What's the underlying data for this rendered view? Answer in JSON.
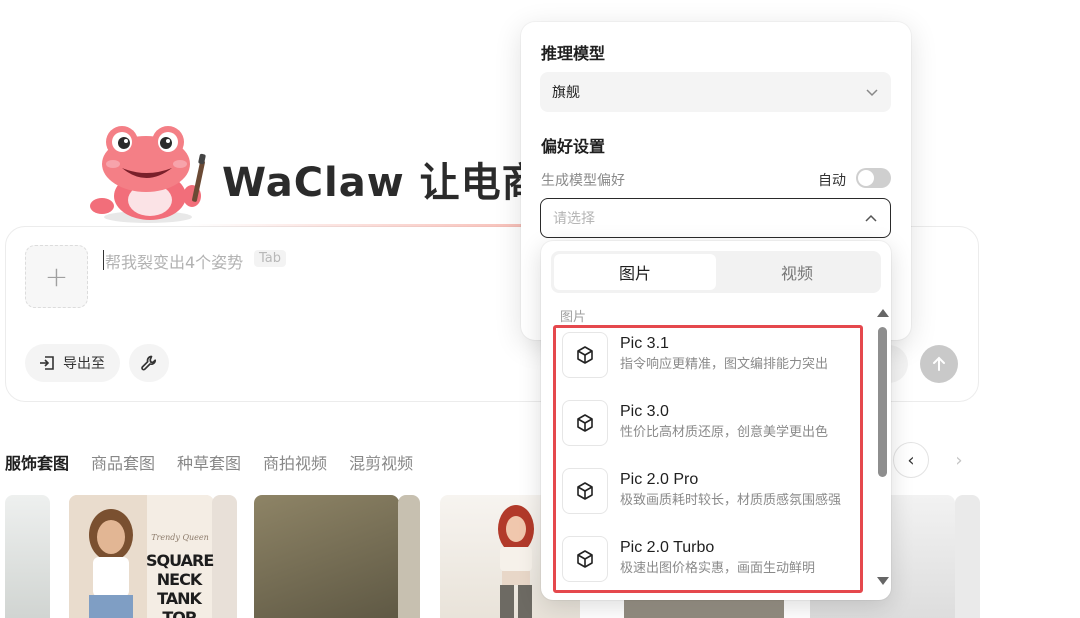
{
  "hero": {
    "title": "WaClaw 让电商"
  },
  "composer": {
    "placeholder": "帮我裂变出4个姿势",
    "tab_hint": "Tab",
    "upload_icon": "plus-icon",
    "export_label": "导出至",
    "export_icon": "export-icon",
    "tools_icon": "wrench-icon",
    "send_icon": "arrow-up-icon"
  },
  "categories": {
    "tabs": [
      "服饰套图",
      "商品套图",
      "种草套图",
      "商拍视频",
      "混剪视频"
    ],
    "active_index": 0,
    "prev_icon": "chevron-left-icon",
    "next_icon": "chevron-right-icon"
  },
  "gallery": {
    "poster_script": "Trendy Queen",
    "poster_title": "SQUARE NECK TANK TOP"
  },
  "settings_panel": {
    "reasoning_heading": "推理模型",
    "reasoning_value": "旗舰",
    "preferences_heading": "偏好设置",
    "gen_model_label": "生成模型偏好",
    "auto_label": "自动",
    "auto_enabled": false,
    "model_select_placeholder": "请选择"
  },
  "model_popover": {
    "tabs": [
      "图片",
      "视频"
    ],
    "active_tab": 0,
    "group_label": "图片",
    "models": [
      {
        "name": "Pic 3.1",
        "desc": "指令响应更精准，图文编排能力突出",
        "icon": "cube-icon"
      },
      {
        "name": "Pic 3.0",
        "desc": "性价比高材质还原，创意美学更出色",
        "icon": "cube-icon"
      },
      {
        "name": "Pic 2.0 Pro",
        "desc": "极致画质耗时较长，材质质感氛围感强",
        "icon": "cube-icon"
      },
      {
        "name": "Pic 2.0 Turbo",
        "desc": "极速出图价格实惠，画面生动鲜明",
        "icon": "cube-icon"
      }
    ]
  },
  "colors": {
    "highlight_frame": "#e5484d",
    "mascot_pink": "#f47f86"
  }
}
